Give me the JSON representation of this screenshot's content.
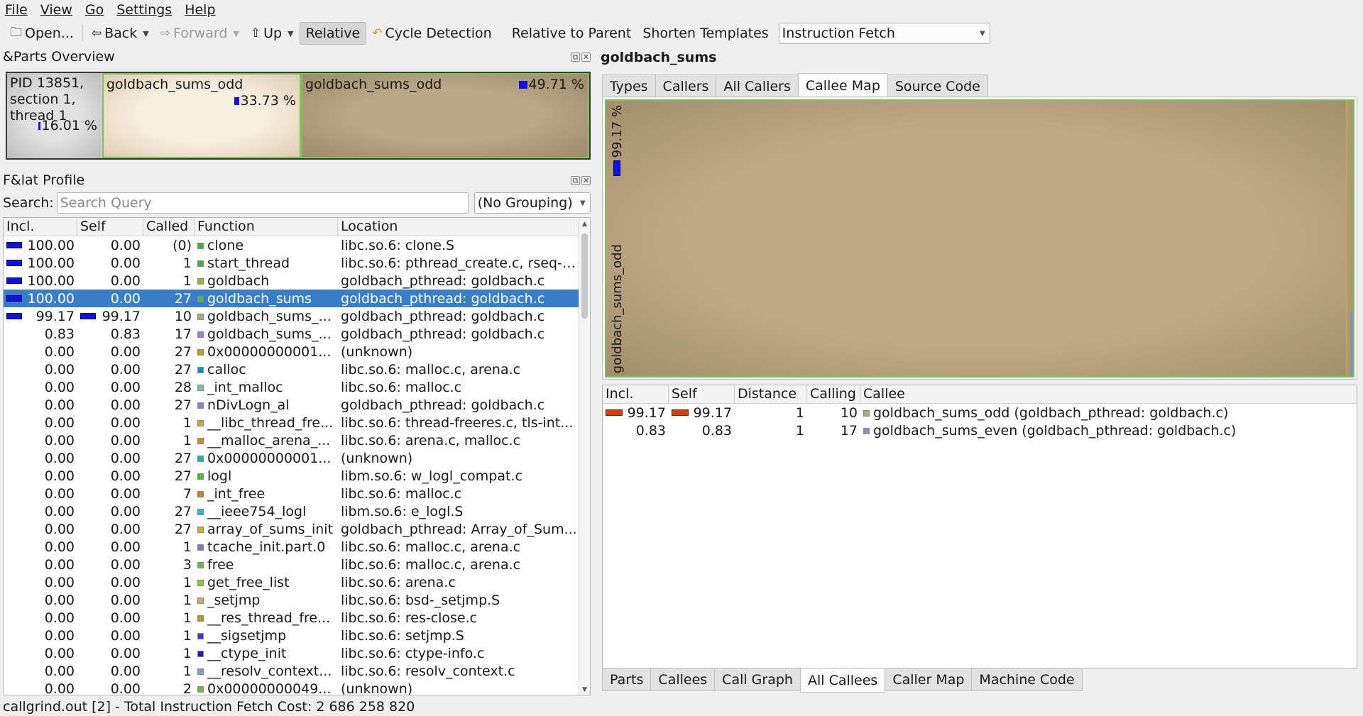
{
  "menu": [
    {
      "key": "file",
      "label": "File"
    },
    {
      "key": "view",
      "label": "View"
    },
    {
      "key": "go",
      "label": "Go"
    },
    {
      "key": "settings",
      "label": "Settings"
    },
    {
      "key": "help",
      "label": "Help"
    }
  ],
  "toolbar": {
    "open": "Open...",
    "back": "Back",
    "forward": "Forward",
    "up": "Up",
    "relative": "Relative",
    "cycle_detection": "Cycle Detection",
    "relative_to_parent": "Relative to Parent",
    "shorten_templates": "Shorten Templates",
    "event_type": "Instruction Fetch"
  },
  "parts_overview": {
    "title": "&Parts Overview",
    "parts": [
      {
        "label": "PID 13851, section 1, thread 1",
        "percent": "16.01 %"
      },
      {
        "label": "goldbach_sums_odd",
        "percent": "33.73 %"
      },
      {
        "label": "goldbach_sums_odd",
        "percent": "49.71 %"
      }
    ]
  },
  "flat_profile": {
    "title": "F&lat Profile",
    "search_label": "Search:",
    "search_placeholder": "Search Query",
    "grouping": "(No Grouping)",
    "columns": [
      "Incl.",
      "Self",
      "Called",
      "Function",
      "Location"
    ],
    "rows": [
      {
        "incl": "100.00",
        "self": "0.00",
        "called": "(0)",
        "function": "clone",
        "location": "libc.so.6: clone.S",
        "color": "#3cb43c",
        "incl_frac": 1.0,
        "self_frac": 0
      },
      {
        "incl": "100.00",
        "self": "0.00",
        "called": "1",
        "function": "start_thread",
        "location": "libc.so.6: pthread_create.c, rseq-i...",
        "color": "#3cb43c",
        "incl_frac": 1.0,
        "self_frac": 0
      },
      {
        "incl": "100.00",
        "self": "0.00",
        "called": "1",
        "function": "goldbach",
        "location": "goldbach_pthread: goldbach.c",
        "color": "#9ab43c",
        "incl_frac": 1.0,
        "self_frac": 0
      },
      {
        "incl": "100.00",
        "self": "0.00",
        "called": "27",
        "function": "goldbach_sums",
        "location": "goldbach_pthread: goldbach.c",
        "color": "#4cb45c",
        "incl_frac": 1.0,
        "self_frac": 0,
        "selected": true
      },
      {
        "incl": "99.17",
        "self": "99.17",
        "called": "10",
        "function": "goldbach_sums_...",
        "location": "goldbach_pthread: goldbach.c",
        "color": "#b4a47c",
        "incl_frac": 0.9917,
        "self_frac": 0.9917
      },
      {
        "incl": "0.83",
        "self": "0.83",
        "called": "17",
        "function": "goldbach_sums_...",
        "location": "goldbach_pthread: goldbach.c",
        "color": "#8c8cc4",
        "incl_frac": 0,
        "self_frac": 0
      },
      {
        "incl": "0.00",
        "self": "0.00",
        "called": "27",
        "function": "0x00000000001...",
        "location": "(unknown)",
        "color": "#c49c1c",
        "incl_frac": 0,
        "self_frac": 0
      },
      {
        "incl": "0.00",
        "self": "0.00",
        "called": "27",
        "function": "calloc",
        "location": "libc.so.6: malloc.c, arena.c",
        "color": "#1c8cc4",
        "incl_frac": 0,
        "self_frac": 0
      },
      {
        "incl": "0.00",
        "self": "0.00",
        "called": "28",
        "function": "_int_malloc",
        "location": "libc.so.6: malloc.c",
        "color": "#7cc49c",
        "incl_frac": 0,
        "self_frac": 0
      },
      {
        "incl": "0.00",
        "self": "0.00",
        "called": "27",
        "function": "nDivLogn_al",
        "location": "goldbach_pthread: goldbach.c",
        "color": "#8c7cd4",
        "incl_frac": 0,
        "self_frac": 0
      },
      {
        "incl": "0.00",
        "self": "0.00",
        "called": "1",
        "function": "__libc_thread_fre...",
        "location": "libc.so.6: thread-freeres.c, tls-int...",
        "color": "#c4a43c",
        "incl_frac": 0,
        "self_frac": 0
      },
      {
        "incl": "0.00",
        "self": "0.00",
        "called": "1",
        "function": "__malloc_arena_...",
        "location": "libc.so.6: arena.c, malloc.c",
        "color": "#d48c2c",
        "incl_frac": 0,
        "self_frac": 0
      },
      {
        "incl": "0.00",
        "self": "0.00",
        "called": "27",
        "function": "0x00000000001...",
        "location": "(unknown)",
        "color": "#1cb4a4",
        "incl_frac": 0,
        "self_frac": 0
      },
      {
        "incl": "0.00",
        "self": "0.00",
        "called": "27",
        "function": "logl",
        "location": "libm.so.6: w_logl_compat.c",
        "color": "#4cbc2c",
        "incl_frac": 0,
        "self_frac": 0
      },
      {
        "incl": "0.00",
        "self": "0.00",
        "called": "7",
        "function": "_int_free",
        "location": "libc.so.6: malloc.c",
        "color": "#c4841c",
        "incl_frac": 0,
        "self_frac": 0
      },
      {
        "incl": "0.00",
        "self": "0.00",
        "called": "27",
        "function": "__ieee754_logl",
        "location": "libm.so.6: e_logl.S",
        "color": "#2cb4cc",
        "incl_frac": 0,
        "self_frac": 0
      },
      {
        "incl": "0.00",
        "self": "0.00",
        "called": "27",
        "function": "array_of_sums_init",
        "location": "goldbach_pthread: Array_of_Sum...",
        "color": "#c4b43c",
        "incl_frac": 0,
        "self_frac": 0
      },
      {
        "incl": "0.00",
        "self": "0.00",
        "called": "1",
        "function": "tcache_init.part.0",
        "location": "libc.so.6: malloc.c, arena.c",
        "color": "#7c7cb4",
        "incl_frac": 0,
        "self_frac": 0
      },
      {
        "incl": "0.00",
        "self": "0.00",
        "called": "3",
        "function": "free",
        "location": "libc.so.6: malloc.c, arena.c",
        "color": "#6cb44c",
        "incl_frac": 0,
        "self_frac": 0
      },
      {
        "incl": "0.00",
        "self": "0.00",
        "called": "1",
        "function": "get_free_list",
        "location": "libc.so.6: arena.c",
        "color": "#8cc43c",
        "incl_frac": 0,
        "self_frac": 0
      },
      {
        "incl": "0.00",
        "self": "0.00",
        "called": "1",
        "function": "_setjmp",
        "location": "libc.so.6: bsd-_setjmp.S",
        "color": "#c4ac6c",
        "incl_frac": 0,
        "self_frac": 0
      },
      {
        "incl": "0.00",
        "self": "0.00",
        "called": "1",
        "function": "__res_thread_fre...",
        "location": "libc.so.6: res-close.c",
        "color": "#b49c2c",
        "incl_frac": 0,
        "self_frac": 0
      },
      {
        "incl": "0.00",
        "self": "0.00",
        "called": "1",
        "function": "__sigsetjmp",
        "location": "libc.so.6: setjmp.S",
        "color": "#3c3cc4",
        "incl_frac": 0,
        "self_frac": 0
      },
      {
        "incl": "0.00",
        "self": "0.00",
        "called": "1",
        "function": "__ctype_init",
        "location": "libc.so.6: ctype-info.c",
        "color": "#1c1cb4",
        "incl_frac": 0,
        "self_frac": 0
      },
      {
        "incl": "0.00",
        "self": "0.00",
        "called": "1",
        "function": "__resolv_context...",
        "location": "libc.so.6: resolv_context.c",
        "color": "#8c9cc4",
        "incl_frac": 0,
        "self_frac": 0
      },
      {
        "incl": "0.00",
        "self": "0.00",
        "called": "2",
        "function": "0x00000000049...",
        "location": "(unknown)",
        "color": "#7cb43c",
        "incl_frac": 0,
        "self_frac": 0
      }
    ]
  },
  "right_panel": {
    "title": "goldbach_sums",
    "top_tabs": [
      {
        "key": "types",
        "label": "Types"
      },
      {
        "key": "callers",
        "label": "Callers"
      },
      {
        "key": "all-callers",
        "label": "All Callers"
      },
      {
        "key": "callee-map",
        "label": "Callee Map",
        "active": true
      },
      {
        "key": "source-code",
        "label": "Source Code"
      }
    ],
    "callee_map": {
      "percent": "99.17 %",
      "label": "goldbach_sums_odd"
    },
    "callees_table": {
      "columns": [
        "Incl.",
        "Self",
        "Distance",
        "Calling",
        "Callee"
      ],
      "rows": [
        {
          "incl": "99.17",
          "self": "99.17",
          "distance": "1",
          "calling": "10",
          "callee": "goldbach_sums_odd (goldbach_pthread: goldbach.c)",
          "color": "#b4a47c",
          "frac": 0.9917
        },
        {
          "incl": "0.83",
          "self": "0.83",
          "distance": "1",
          "calling": "17",
          "callee": "goldbach_sums_even (goldbach_pthread: goldbach.c)",
          "color": "#8c8cc4",
          "frac": 0
        }
      ]
    },
    "bottom_tabs": [
      {
        "key": "parts",
        "label": "Parts"
      },
      {
        "key": "callees",
        "label": "Callees"
      },
      {
        "key": "call-graph",
        "label": "Call Graph"
      },
      {
        "key": "all-callees",
        "label": "All Callees",
        "active": true
      },
      {
        "key": "caller-map",
        "label": "Caller Map"
      },
      {
        "key": "machine-code",
        "label": "Machine Code"
      }
    ]
  },
  "status_bar": "callgrind.out [2] - Total Instruction Fetch Cost: 2 686 258 820"
}
